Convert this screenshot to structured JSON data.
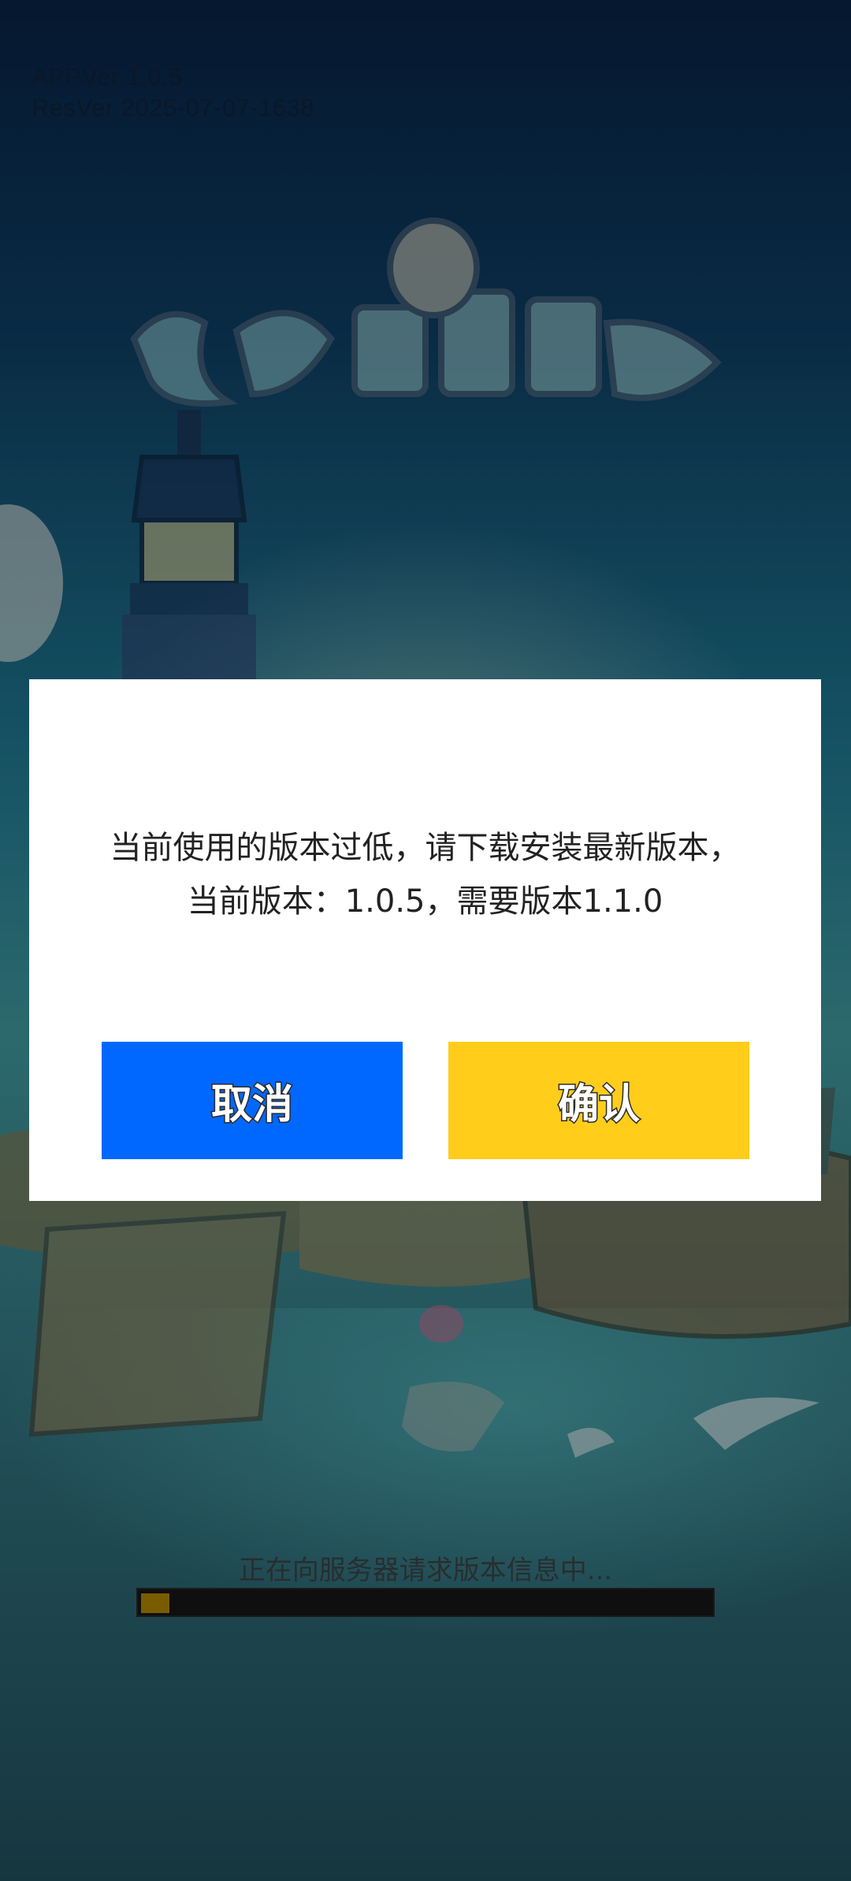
{
  "version_info": {
    "app_ver": "APPVer 1.0.5",
    "res_ver": "ResVer 2025-07-07-1638"
  },
  "dialog": {
    "message_line1": "当前使用的版本过低，请下载安装最新版本，",
    "message_line2": "当前版本：1.0.5，需要版本1.1.0",
    "cancel_label": "取消",
    "confirm_label": "确认"
  },
  "loading": {
    "status_text": "正在向服务器请求版本信息中...",
    "progress_fraction": 0.05
  },
  "colors": {
    "cancel_button": "#0068ff",
    "confirm_button": "#ffcd1a",
    "progress_fill": "#7a5c00",
    "dialog_background": "#ffffff"
  }
}
